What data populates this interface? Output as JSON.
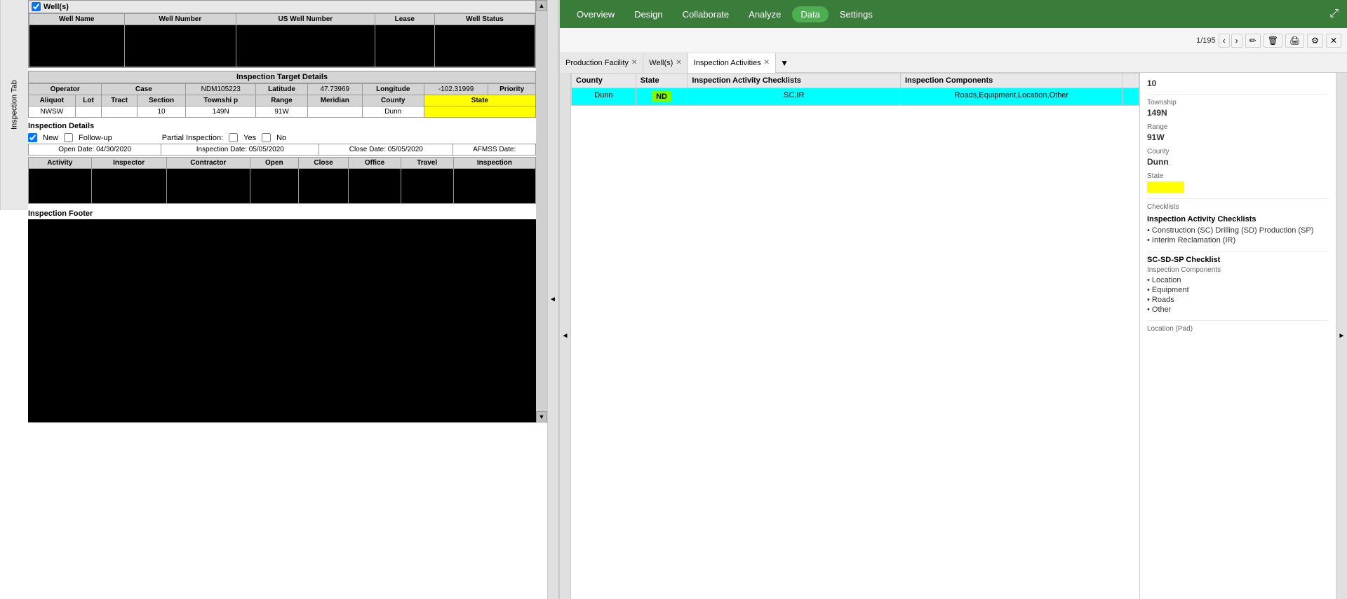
{
  "leftPanel": {
    "tabLabel": "Inspection Tab",
    "wellsSection": {
      "title": "Well(s)",
      "columns": [
        "Well Name",
        "Well Number",
        "US Well Number",
        "Lease",
        "Well Status"
      ]
    },
    "targetDetails": {
      "sectionTitle": "Inspection Target Details",
      "operatorLabel": "Operator",
      "caseLabel": "Case",
      "caseValue": "NDM105223",
      "latitudeLabel": "Latitude",
      "latitudeValue": "47.73969",
      "longitudeLabel": "Longitude",
      "longitudeValue": "-102.31999",
      "priorityLabel": "Priority",
      "aliquotLabel": "Aliquot",
      "aliquotValue": "NWSW",
      "lotLabel": "Lot",
      "tractLabel": "Tract",
      "sectionLabel": "Section",
      "sectionValue": "10",
      "townshipLabel": "Townshi p",
      "townshipValue": "149N",
      "rangeLabel": "Range",
      "rangeValue": "91W",
      "meridianLabel": "Meridian",
      "countyLabel": "County",
      "countyValue": "Dunn",
      "stateLabel": "State"
    },
    "inspectionDetails": {
      "header": "Inspection Details",
      "newLabel": "New",
      "followupLabel": "Follow-up",
      "partialLabel": "Partial Inspection:",
      "yesLabel": "Yes",
      "noLabel": "No",
      "openDateLabel": "Open Date:",
      "openDateValue": "04/30/2020",
      "inspectionDateLabel": "Inspection Date:",
      "inspectionDateValue": "05/05/2020",
      "closeDateLabel": "Close Date:",
      "closeDateValue": "05/05/2020",
      "afmssDateLabel": "AFMSS Date:",
      "activityColumns": [
        "Activity",
        "Inspector",
        "Contractor",
        "Open",
        "Close",
        "Office",
        "Travel",
        "Inspection"
      ]
    },
    "footer": {
      "header": "Inspection Footer"
    }
  },
  "rightPanel": {
    "nav": {
      "items": [
        "Overview",
        "Design",
        "Collaborate",
        "Analyze",
        "Data",
        "Settings"
      ],
      "activeItem": "Data",
      "shareIcon": "share"
    },
    "toolbar": {
      "pageCount": "1/195",
      "navPrev": "‹",
      "navNext": "›",
      "editIcon": "✏",
      "deleteIcon": "🗑",
      "printIcon": "🖨",
      "settingsIcon": "⚙",
      "closeIcon": "✕"
    },
    "tabs": [
      {
        "label": "Production Facility",
        "closeable": true
      },
      {
        "label": "Well(s)",
        "closeable": true
      },
      {
        "label": "Inspection Activities",
        "closeable": true,
        "active": true
      }
    ],
    "tableColumns": [
      "County",
      "State",
      "Inspection Activity Checklists",
      "Inspection Components"
    ],
    "tableRows": [
      {
        "county": "Dunn",
        "state": "ND",
        "checklists": "SC,IR",
        "components": "Roads,Equipment,Location,Other",
        "selected": true
      }
    ],
    "detailsPanel": {
      "pageCount": "10",
      "township": {
        "label": "Township",
        "value": "149N"
      },
      "range": {
        "label": "Range",
        "value": "91W"
      },
      "county": {
        "label": "County",
        "value": "Dunn"
      },
      "state": {
        "label": "State",
        "value": ""
      },
      "checklists": {
        "label": "Checklists",
        "inspectionActivityChecklistsLabel": "Inspection Activity Checklists",
        "items": [
          "Construction (SC) Drilling (SD) Production (SP)",
          "Interim Reclamation (IR)"
        ]
      },
      "scSdSpChecklist": {
        "label": "SC-SD-SP Checklist",
        "componentsLabel": "Inspection Components",
        "items": [
          "Location",
          "Equipment",
          "Roads",
          "Other"
        ]
      },
      "locationPadLabel": "Location (Pad)"
    }
  }
}
